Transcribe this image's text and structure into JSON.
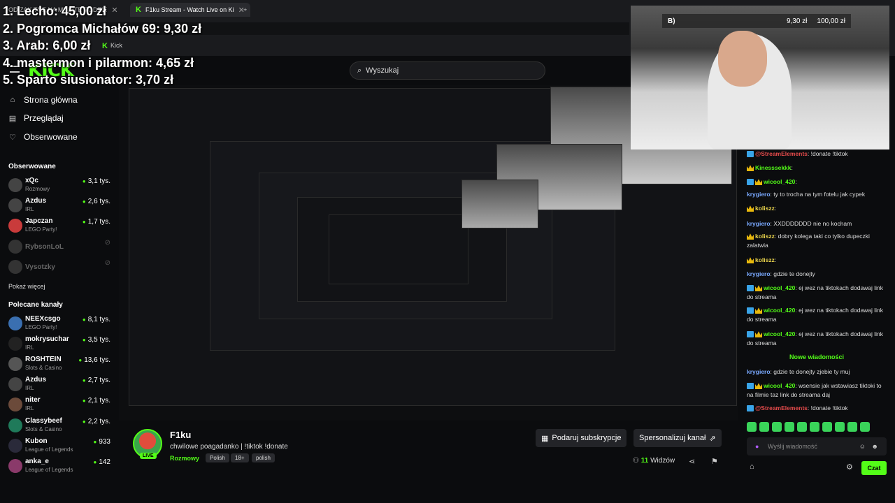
{
  "browser": {
    "tabs": [
      {
        "label": "OD ZAK TNE NA MINUTE PODZIE"
      },
      {
        "label": "F1ku Stream - Watch Live on Ki"
      }
    ],
    "bookmark_label": "Kick"
  },
  "leaderboard": [
    "1. Lecho: 45,00 zł",
    "2. Pogromca Michałów 69: 9,30 zł",
    "3. Arab: 6,00 zł",
    "4. mastermon i pilarmon: 4,65 zł",
    "5. Sparto siusionator: 3,70 zł"
  ],
  "header": {
    "logo": "KICK",
    "search_placeholder": "Wyszukaj"
  },
  "nav": [
    {
      "label": "Strona główna",
      "icon": "home-icon"
    },
    {
      "label": "Przeglądaj",
      "icon": "browse-icon"
    },
    {
      "label": "Obserwowane",
      "icon": "heart-icon"
    }
  ],
  "followed_title": "Obserwowane",
  "followed": [
    {
      "name": "xQc",
      "category": "Rozmowy",
      "viewers": "3,1 tys."
    },
    {
      "name": "Azdus",
      "category": "IRL",
      "viewers": "2,6 tys."
    },
    {
      "name": "Japczan",
      "category": "LEGO Party!",
      "viewers": "1,7 tys."
    },
    {
      "name": "RybsonLoL",
      "category": "",
      "viewers": ""
    },
    {
      "name": "Vysotzky",
      "category": "",
      "viewers": ""
    }
  ],
  "show_more": "Pokaż więcej",
  "recommended_title": "Polecane kanały",
  "recommended": [
    {
      "name": "NEEXcsgo",
      "category": "LEGO Party!",
      "viewers": "8,1 tys."
    },
    {
      "name": "mokrysuchar",
      "category": "IRL",
      "viewers": "3,5 tys."
    },
    {
      "name": "ROSHTEIN",
      "category": "Slots & Casino",
      "viewers": "13,6 tys."
    },
    {
      "name": "Azdus",
      "category": "IRL",
      "viewers": "2,7 tys."
    },
    {
      "name": "niter",
      "category": "IRL",
      "viewers": "2,1 tys."
    },
    {
      "name": "Classybeef",
      "category": "Slots & Casino",
      "viewers": "2,2 tys."
    },
    {
      "name": "Kubon",
      "category": "League of Legends",
      "viewers": "933"
    },
    {
      "name": "anka_e",
      "category": "League of Legends",
      "viewers": "142"
    }
  ],
  "stream": {
    "name": "F1ku",
    "title": "chwilowe poagadanko | !tiktok !donate",
    "category": "Rozmowy",
    "tags": [
      "Polish",
      "18+",
      "polish"
    ],
    "live_label": "LIVE",
    "viewers_count": "11",
    "viewers_label": "Widzów",
    "gift_button": "Podaruj subskrypcje",
    "customize_button": "Spersonalizuj kanał"
  },
  "cam_overlay": {
    "label": "B)",
    "current": "9,30 zł",
    "goal": "100,00 zł"
  },
  "chat": {
    "messages": [
      {
        "user": "@StreamElements",
        "text": ": !donate !tiktok",
        "color": "#e84c4c",
        "badges": [
          "boost"
        ]
      },
      {
        "user": "Kinesssekkk",
        "text": ":",
        "color": "#53fc18",
        "badges": [
          "crown"
        ]
      },
      {
        "user": "wicool_420",
        "text": ":",
        "color": "#53fc18",
        "badges": [
          "boost",
          "crown"
        ]
      },
      {
        "user": "krygiero",
        "text": ": ty to trocha na tym fotelu jak cypek",
        "color": "#7aa9ff",
        "badges": []
      },
      {
        "user": "koliszz",
        "text": ":",
        "color": "#e8d34c",
        "badges": [
          "crown"
        ]
      },
      {
        "user": "krygiero",
        "text": ": XXDDDDDDD nie no kocham",
        "color": "#7aa9ff",
        "badges": []
      },
      {
        "user": "koliszz",
        "text": ": dobry kolega taki co tylko dupeczki zalatwia",
        "color": "#e8d34c",
        "badges": [
          "crown"
        ]
      },
      {
        "user": "koliszz",
        "text": ":",
        "color": "#e8d34c",
        "badges": [
          "crown"
        ]
      },
      {
        "user": "krygiero",
        "text": ": gdzie te donejty",
        "color": "#7aa9ff",
        "badges": []
      },
      {
        "user": "wicool_420",
        "text": ": ej wez na tiktokach dodawaj link do streama",
        "color": "#53fc18",
        "badges": [
          "boost",
          "crown"
        ]
      },
      {
        "user": "wicool_420",
        "text": ": ej wez na tiktokach dodawaj link do streama",
        "color": "#53fc18",
        "badges": [
          "boost",
          "crown"
        ]
      },
      {
        "user": "wicool_420",
        "text": ": ej wez na tiktokach dodawaj link do streama",
        "color": "#53fc18",
        "badges": [
          "boost",
          "crown"
        ]
      }
    ],
    "divider": "Nowe wiadomości",
    "new_messages": [
      {
        "user": "krygiero",
        "text": ": gdzie te donejty zjebie ty muj",
        "color": "#7aa9ff",
        "badges": []
      },
      {
        "user": "wicool_420",
        "text": ": wsensie jak wstawiasz tiktoki to na filmie taz link do streama daj",
        "color": "#53fc18",
        "badges": [
          "boost",
          "crown"
        ]
      },
      {
        "user": "@StreamElements",
        "text": ": !donate !tiktok",
        "color": "#e84c4c",
        "badges": [
          "boost"
        ]
      }
    ],
    "input_placeholder": "Wyślij wiadomość",
    "send_label": "Czat"
  }
}
